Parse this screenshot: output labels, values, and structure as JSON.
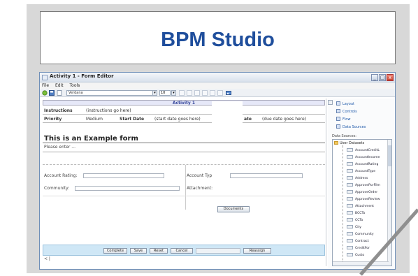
{
  "slide": {
    "title": "BPM Studio"
  },
  "window": {
    "title": "Activity 1 - Form Editor",
    "controls": {
      "minimize": "_",
      "maximize": "□",
      "close": "x"
    }
  },
  "menubar": {
    "items": [
      "File",
      "Edit",
      "Tools"
    ]
  },
  "toolbar": {
    "font": "Verdana",
    "size": "10"
  },
  "form": {
    "activity_title": "Activity 1",
    "instructions_label": "Instructions",
    "instructions_value": "(instructions go here)",
    "priority_label": "Priority",
    "priority_value": "Medium",
    "start_date_label": "Start Date",
    "start_date_value": "(start date goes here)",
    "due_date_label": "ate",
    "due_date_value": "(due date goes here)",
    "heading": "This is an Example form",
    "please_enter": "Please enter ...",
    "account_rating_label": "Account Rating:",
    "account_type_label": "Account Typ",
    "community_label": "Community:",
    "attachment_label": "Attachment:",
    "documents_button": "Documents",
    "buttons": {
      "complete": "Complete",
      "save": "Save",
      "reset": "Reset",
      "cancel": "Cancel",
      "reassign": "Reassign"
    },
    "cursor_line": "< |"
  },
  "panel": {
    "items": [
      "Layout",
      "Controls",
      "Flow",
      "Data Sources"
    ],
    "data_sources_label": "Data Sources:",
    "tree_root": "User Datasets",
    "tree_items": [
      "AccountCreditL",
      "AccountIncome",
      "AccountRating",
      "AccountType",
      "Address",
      "ApprovePurFilm",
      "ApproveOrder",
      "ApproveReview",
      "Attachment",
      "BCCTo",
      "CCTo",
      "City",
      "Community",
      "Contract",
      "CreditFor",
      "Custo"
    ]
  },
  "colors": {
    "title": "#1f4e9c",
    "button_bar": "#cfe7f6",
    "window_border": "#6f8fb8"
  }
}
